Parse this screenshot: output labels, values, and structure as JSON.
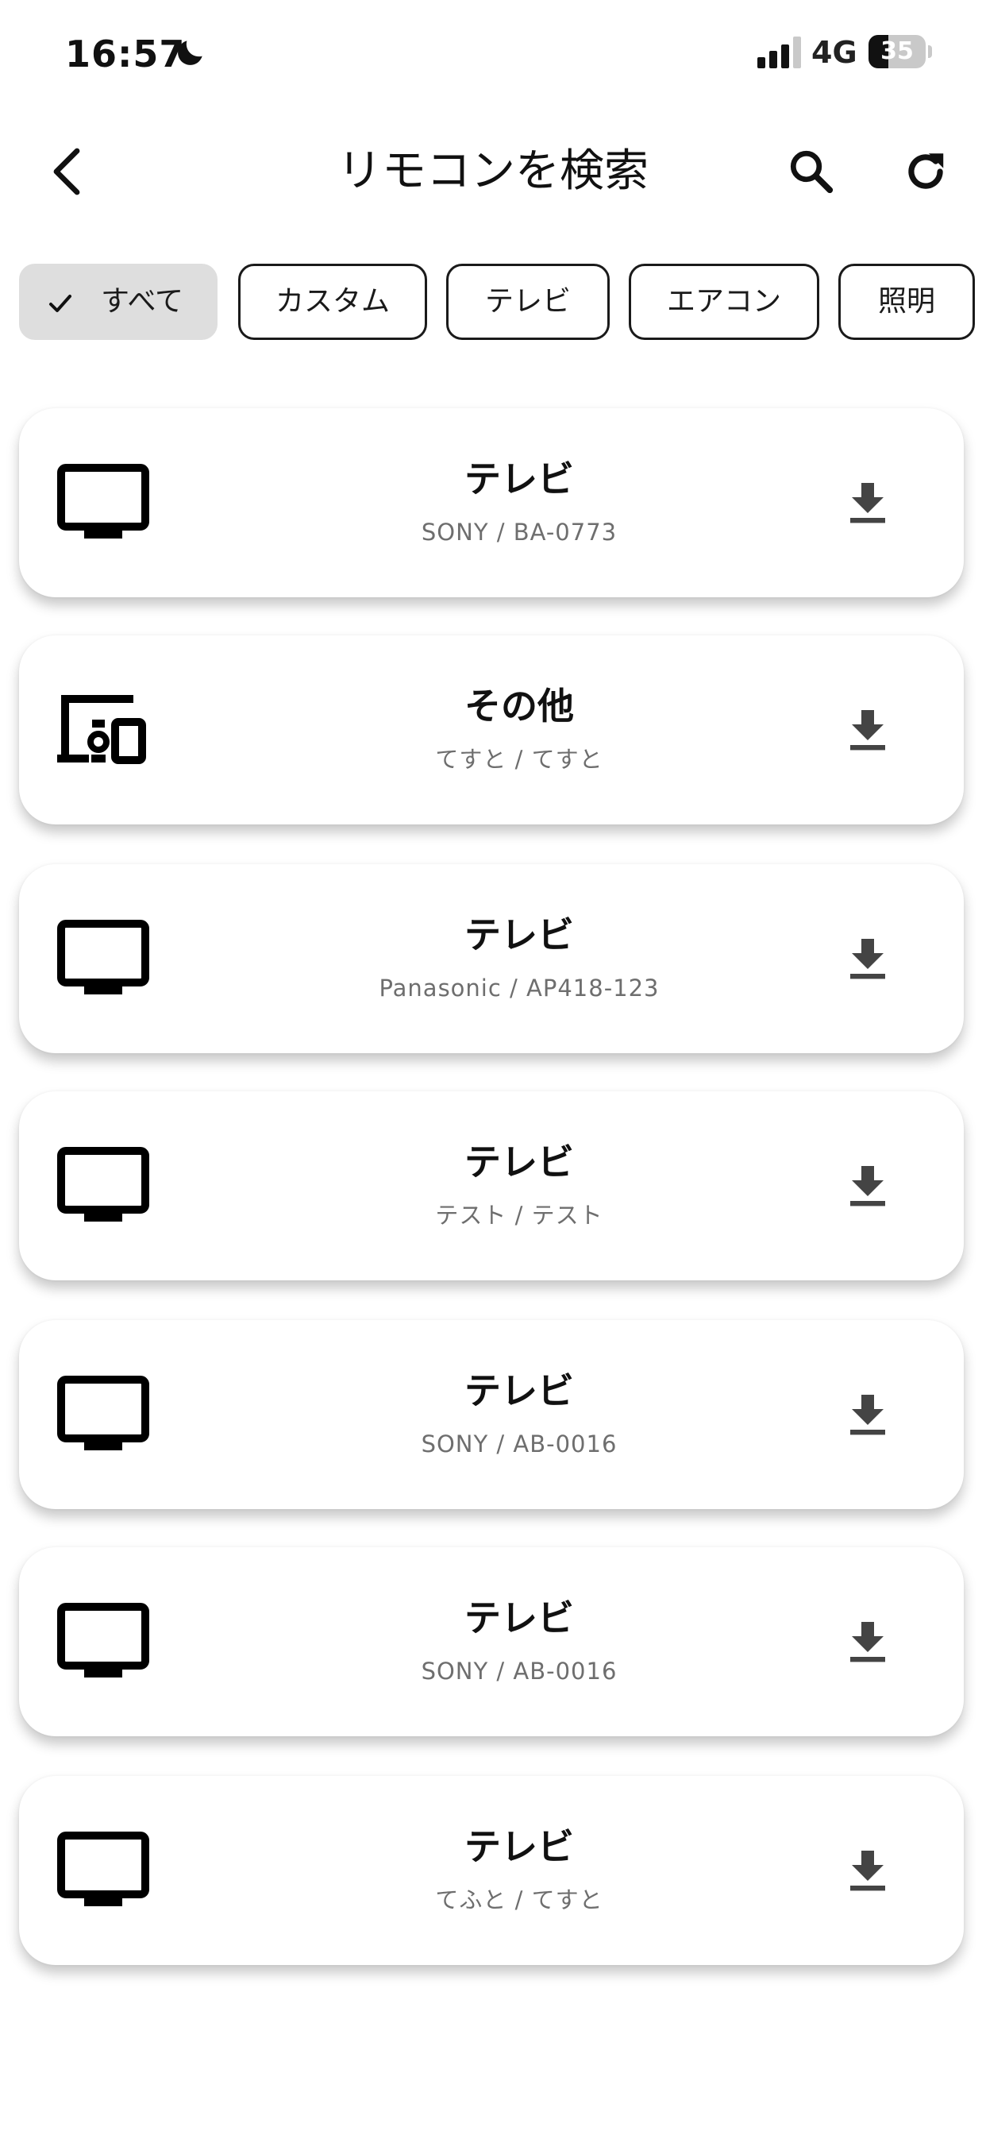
{
  "status_bar": {
    "time": "16:57",
    "network": "4G",
    "battery_level": "35",
    "battery_fraction": 0.35,
    "icons": [
      "moon-icon",
      "signal-icon",
      "battery-icon"
    ]
  },
  "app_bar": {
    "title": "リモコンを検索",
    "icons": [
      "back-arrow-icon",
      "search-icon",
      "refresh-icon"
    ]
  },
  "filters": {
    "selected_index": 0,
    "chips": [
      {
        "label": "すべて"
      },
      {
        "label": "カスタム"
      },
      {
        "label": "テレビ"
      },
      {
        "label": "エアコン"
      },
      {
        "label": "照明"
      }
    ]
  },
  "remotes": [
    {
      "icon": "tv-icon",
      "title": "テレビ",
      "subtitle": "SONY / BA-0773"
    },
    {
      "icon": "devices-other-icon",
      "title": "その他",
      "subtitle": "てすと / てすと"
    },
    {
      "icon": "tv-icon",
      "title": "テレビ",
      "subtitle": "Panasonic / AP418-123"
    },
    {
      "icon": "tv-icon",
      "title": "テレビ",
      "subtitle": "テスト / テスト"
    },
    {
      "icon": "tv-icon",
      "title": "テレビ",
      "subtitle": "SONY / AB-0016"
    },
    {
      "icon": "tv-icon",
      "title": "テレビ",
      "subtitle": "SONY / AB-0016"
    },
    {
      "icon": "tv-icon",
      "title": "テレビ",
      "subtitle": "てふと / てすと"
    }
  ],
  "colors": {
    "text": "#111111",
    "subtitle": "#6e6e6e",
    "chip_selected_bg": "#dedede",
    "download_icon": "#444444"
  }
}
